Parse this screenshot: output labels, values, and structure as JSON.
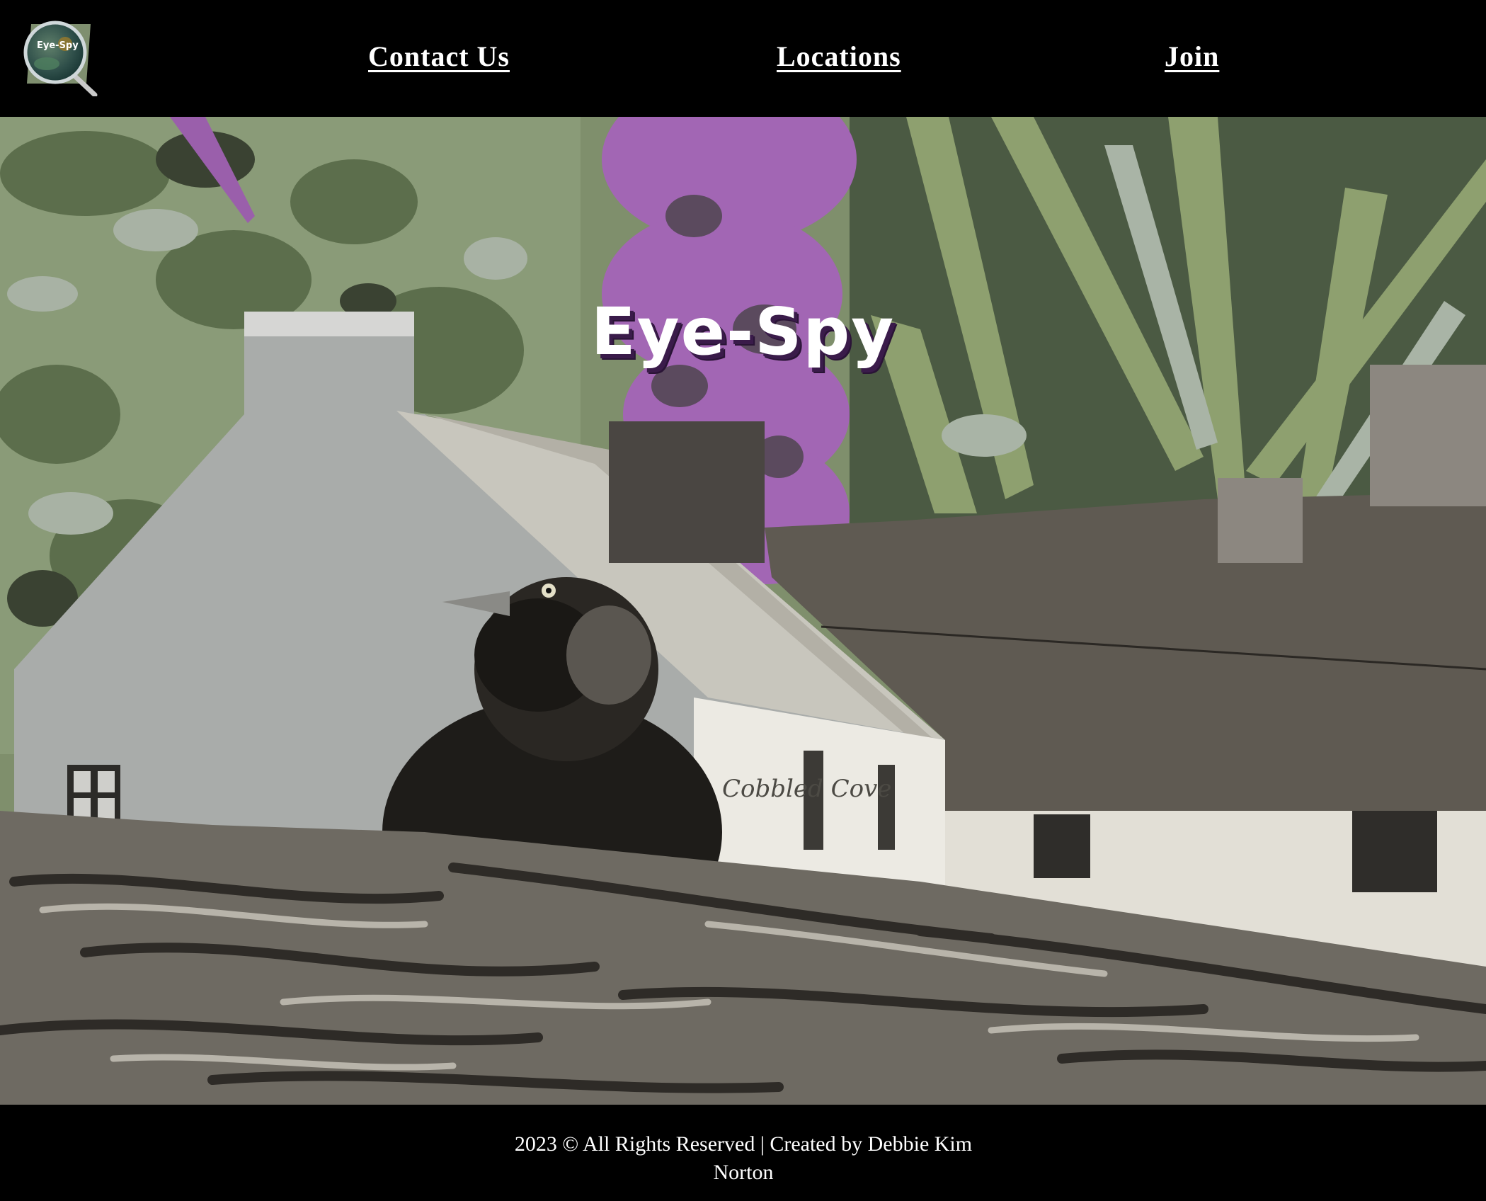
{
  "header": {
    "logo_text": "Eye-Spy",
    "nav": {
      "contact": "Contact Us",
      "locations": "Locations",
      "join": "Join"
    }
  },
  "hero": {
    "title": "Eye-Spy",
    "image_subject": "jackdaw on thatched roof with white cottage and foliage",
    "sign_text": "Cobbled Cove"
  },
  "footer": {
    "copyright": "2023 © All Rights Reserved | Created by Debbie Kim Norton"
  },
  "colors": {
    "background": "#000000",
    "title_shadow": "#3a1b4a",
    "foliage_light": "#8fa070",
    "foliage_dark": "#3f4d35",
    "flowers": "#a266b4"
  },
  "icons": [
    "magnifier-logo-icon"
  ]
}
